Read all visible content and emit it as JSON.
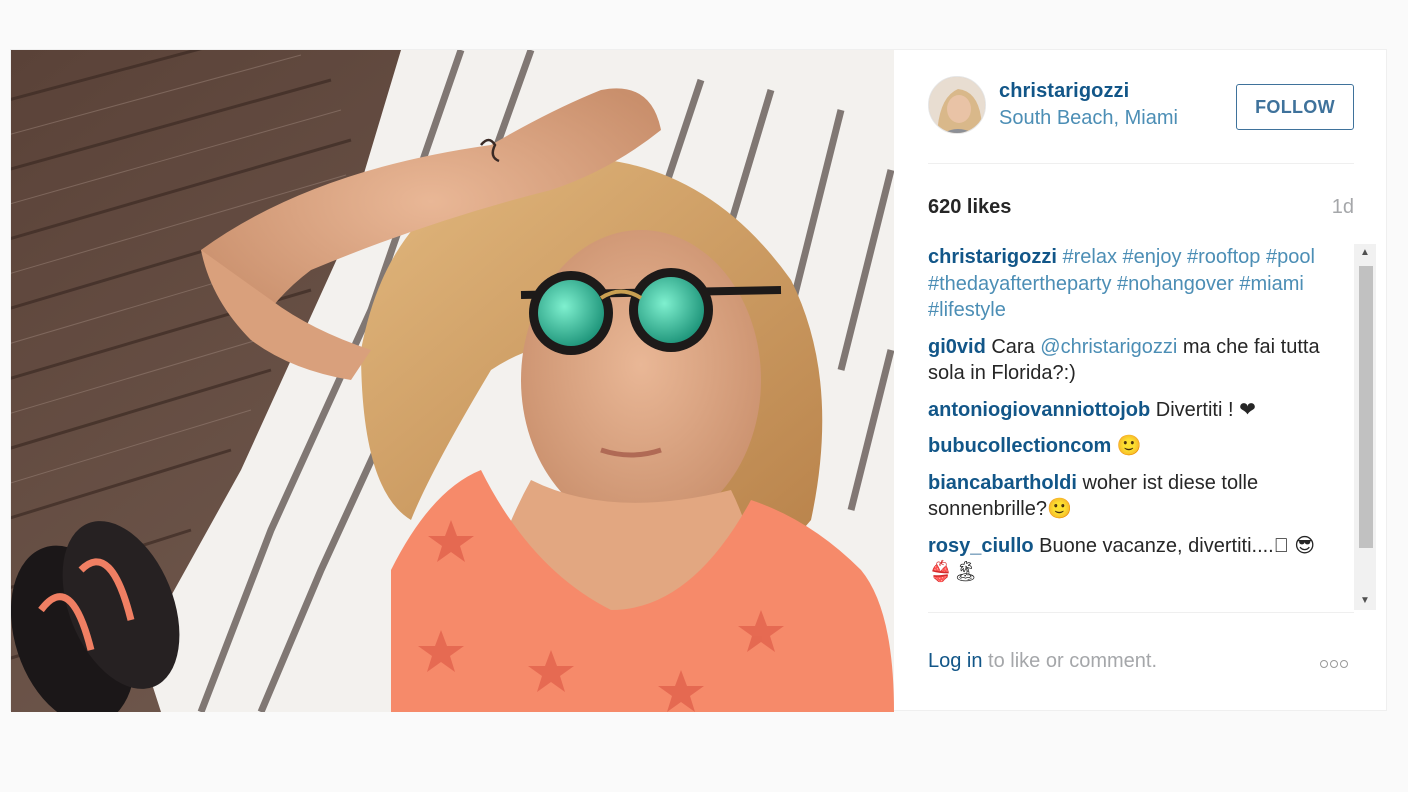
{
  "post": {
    "username": "christarigozzi",
    "location": "South Beach, Miami",
    "follow_label": "FOLLOW",
    "likes": "620 likes",
    "time_ago": "1d"
  },
  "caption": {
    "user": "christarigozzi",
    "tags": "#relax #enjoy #rooftop #pool #thedayaftertheparty #nohangover #miami #lifestyle"
  },
  "comments": [
    {
      "user": "gi0vid",
      "pre": "Cara ",
      "mention": "@christarigozzi",
      "post": " ma che fai tutta sola in Florida?:)"
    },
    {
      "user": "antoniogiovanniottojob",
      "text": "Divertiti ! ❤"
    },
    {
      "user": "bubucollectioncom",
      "text": "🙂"
    },
    {
      "user": "biancabartholdi",
      "text": "woher ist diese tolle sonnenbrille?🙂"
    },
    {
      "user": "rosy_ciullo",
      "text": "Buone vacanze, divertiti....􏿽 😎👙🏝"
    }
  ],
  "footer": {
    "login_link": "Log in",
    "login_rest": " to like or comment."
  },
  "colors": {
    "link_dark": "#125688",
    "link_light": "#4c8eb5",
    "follow_border": "#3f729b",
    "muted": "#a5a7aa"
  },
  "icons": {
    "more": "more-options-icon",
    "scroll_up": "scroll-up-arrow-icon",
    "scroll_down": "scroll-down-arrow-icon"
  }
}
